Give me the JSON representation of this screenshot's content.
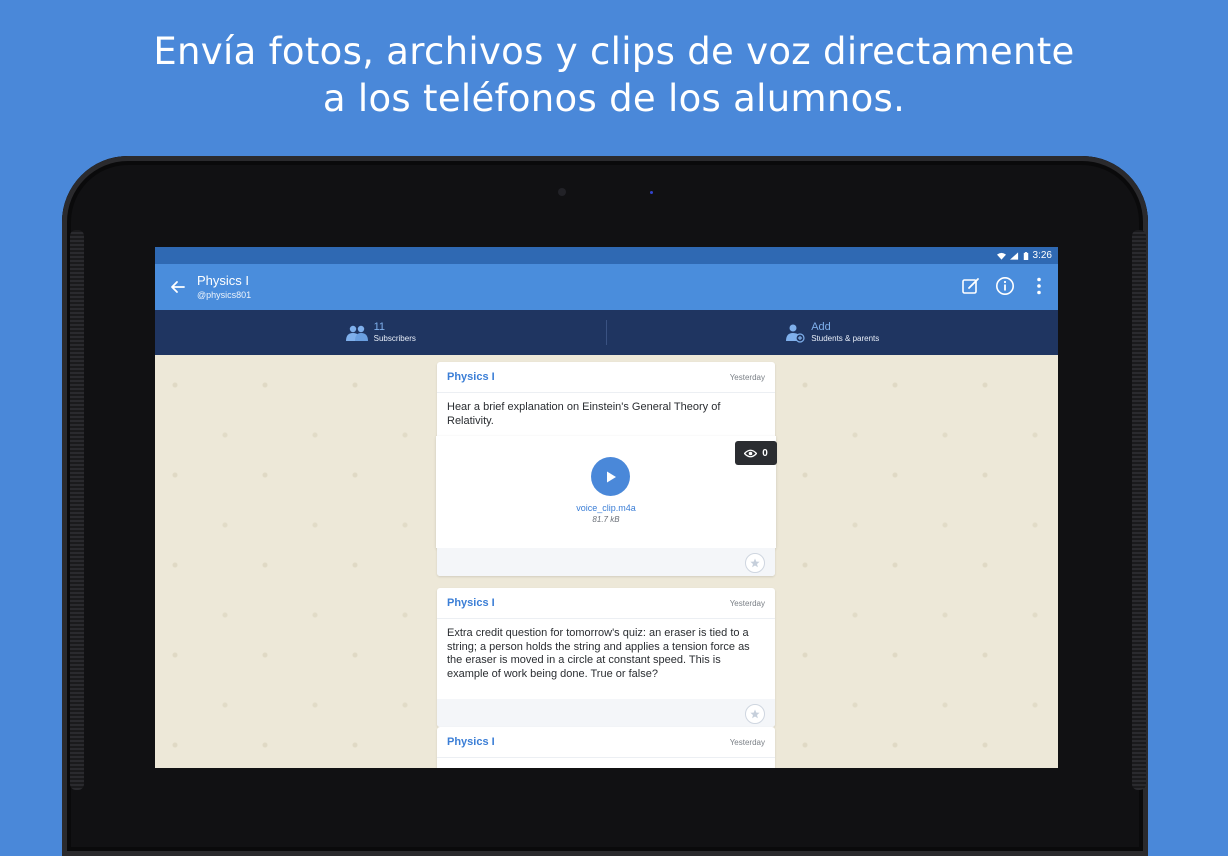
{
  "headline": {
    "line1": "Envía fotos, archivos y clips de voz directamente",
    "line2": "a los teléfonos de los alumnos."
  },
  "status_bar": {
    "time": "3:26"
  },
  "app_bar": {
    "title": "Physics I",
    "handle": "@physics801",
    "icons": [
      "back-arrow-icon",
      "compose-icon",
      "info-icon",
      "more-vert-icon"
    ]
  },
  "sub_bar": {
    "subscribers": {
      "count": "11",
      "label": "Subscribers",
      "icon": "people-icon"
    },
    "add": {
      "title": "Add",
      "label": "Students & parents",
      "icon": "add-person-icon"
    }
  },
  "messages": [
    {
      "sender": "Physics I",
      "date": "Yesterday",
      "text": "Hear a brief explanation on Einstein's General Theory of Relativity.",
      "attachment": {
        "file_name": "voice_clip.m4a",
        "file_size": "81.7 kB",
        "views": "0"
      }
    },
    {
      "sender": "Physics I",
      "date": "Yesterday",
      "text": "Extra credit question for tomorrow's quiz: an eraser is tied to a string; a person holds the string and applies a tension force as the eraser is moved in a circle at constant speed. This is example of work being done. True or false?"
    },
    {
      "sender": "Physics I",
      "date": "Yesterday"
    }
  ],
  "colors": {
    "background": "#4a88d9",
    "app_bar": "#4a8ddc",
    "sub_bar": "#1f3561",
    "accent": "#3b7ed6"
  }
}
